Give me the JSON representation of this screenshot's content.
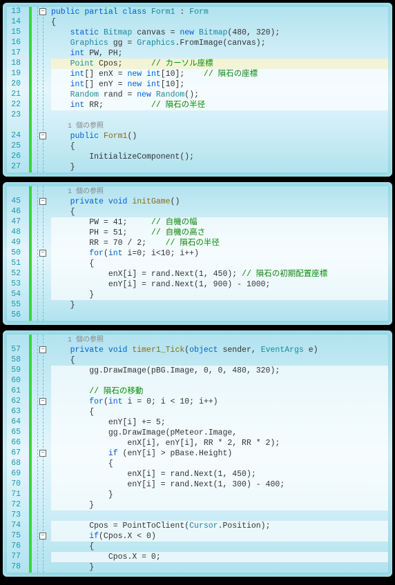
{
  "panels": [
    {
      "lines": [
        {
          "num": "13",
          "fold": "-",
          "cls": "",
          "tokens": [
            [
              "kw",
              "public"
            ],
            [
              "",
              " "
            ],
            [
              "kw",
              "partial"
            ],
            [
              "",
              " "
            ],
            [
              "kw",
              "class"
            ],
            [
              "",
              " "
            ],
            [
              "type",
              "Form1"
            ],
            [
              "",
              " : "
            ],
            [
              "type",
              "Form"
            ]
          ]
        },
        {
          "num": "14",
          "fold": "",
          "cls": "",
          "tokens": [
            [
              "",
              "{"
            ]
          ]
        },
        {
          "num": "15",
          "fold": "",
          "cls": "",
          "tokens": [
            [
              "",
              "    "
            ],
            [
              "kw",
              "static"
            ],
            [
              "",
              " "
            ],
            [
              "type",
              "Bitmap"
            ],
            [
              "",
              " canvas = "
            ],
            [
              "kw",
              "new"
            ],
            [
              "",
              " "
            ],
            [
              "type",
              "Bitmap"
            ],
            [
              "",
              "(480, 320);"
            ]
          ]
        },
        {
          "num": "16",
          "fold": "",
          "cls": "",
          "tokens": [
            [
              "",
              "    "
            ],
            [
              "type",
              "Graphics"
            ],
            [
              "",
              " gg = "
            ],
            [
              "type",
              "Graphics"
            ],
            [
              "",
              ".FromImage(canvas);"
            ]
          ]
        },
        {
          "num": "17",
          "fold": "",
          "cls": "",
          "tokens": [
            [
              "",
              "    "
            ],
            [
              "kw",
              "int"
            ],
            [
              "",
              " PW, PH;"
            ]
          ]
        },
        {
          "num": "18",
          "fold": "",
          "cls": "hl-y",
          "tokens": [
            [
              "",
              "    "
            ],
            [
              "type",
              "Point"
            ],
            [
              "",
              " Cpos;      "
            ],
            [
              "comment",
              "// カーソル座標"
            ]
          ]
        },
        {
          "num": "19",
          "fold": "",
          "cls": "hl",
          "tokens": [
            [
              "",
              "    "
            ],
            [
              "kw",
              "int"
            ],
            [
              "",
              "[] enX = "
            ],
            [
              "kw",
              "new"
            ],
            [
              "",
              " "
            ],
            [
              "kw",
              "int"
            ],
            [
              "",
              "[10];    "
            ],
            [
              "comment",
              "// 隕石の座標"
            ]
          ]
        },
        {
          "num": "20",
          "fold": "",
          "cls": "hl",
          "tokens": [
            [
              "",
              "    "
            ],
            [
              "kw",
              "int"
            ],
            [
              "",
              "[] enY = "
            ],
            [
              "kw",
              "new"
            ],
            [
              "",
              " "
            ],
            [
              "kw",
              "int"
            ],
            [
              "",
              "[10];"
            ]
          ]
        },
        {
          "num": "21",
          "fold": "",
          "cls": "hl",
          "tokens": [
            [
              "",
              "    "
            ],
            [
              "type",
              "Random"
            ],
            [
              "",
              " rand = "
            ],
            [
              "kw",
              "new"
            ],
            [
              "",
              " "
            ],
            [
              "type",
              "Random"
            ],
            [
              "",
              "();"
            ]
          ]
        },
        {
          "num": "22",
          "fold": "",
          "cls": "hl",
          "tokens": [
            [
              "",
              "    "
            ],
            [
              "kw",
              "int"
            ],
            [
              "",
              " RR;          "
            ],
            [
              "comment",
              "// 隕石の半径"
            ]
          ]
        },
        {
          "num": "23",
          "fold": "",
          "cls": "",
          "tokens": [
            [
              "",
              ""
            ]
          ]
        },
        {
          "num": "",
          "fold": "",
          "cls": "",
          "tokens": [
            [
              "ref-label",
              "    1 個の参照"
            ]
          ]
        },
        {
          "num": "24",
          "fold": "-",
          "cls": "",
          "tokens": [
            [
              "",
              "    "
            ],
            [
              "kw",
              "public"
            ],
            [
              "",
              " "
            ],
            [
              "method",
              "Form1"
            ],
            [
              "",
              "()"
            ]
          ]
        },
        {
          "num": "25",
          "fold": "",
          "cls": "",
          "tokens": [
            [
              "",
              "    {"
            ]
          ]
        },
        {
          "num": "26",
          "fold": "",
          "cls": "",
          "tokens": [
            [
              "",
              "        InitializeComponent();"
            ]
          ]
        },
        {
          "num": "27",
          "fold": "",
          "cls": "",
          "tokens": [
            [
              "",
              "    }"
            ]
          ]
        }
      ]
    },
    {
      "lines": [
        {
          "num": "",
          "fold": "",
          "cls": "",
          "tokens": [
            [
              "ref-label",
              "    1 個の参照"
            ]
          ]
        },
        {
          "num": "45",
          "fold": "-",
          "cls": "",
          "tokens": [
            [
              "",
              "    "
            ],
            [
              "kw",
              "private"
            ],
            [
              "",
              " "
            ],
            [
              "kw",
              "void"
            ],
            [
              "",
              " "
            ],
            [
              "method",
              "initGame"
            ],
            [
              "",
              "()"
            ]
          ]
        },
        {
          "num": "46",
          "fold": "",
          "cls": "",
          "tokens": [
            [
              "",
              "    {"
            ]
          ]
        },
        {
          "num": "47",
          "fold": "",
          "cls": "hl",
          "tokens": [
            [
              "",
              "        PW = 41;     "
            ],
            [
              "comment",
              "// 自機の幅"
            ]
          ]
        },
        {
          "num": "48",
          "fold": "",
          "cls": "hl",
          "tokens": [
            [
              "",
              "        PH = 51;     "
            ],
            [
              "comment",
              "// 自機の高さ"
            ]
          ]
        },
        {
          "num": "49",
          "fold": "",
          "cls": "hl",
          "tokens": [
            [
              "",
              "        RR = 70 / 2;    "
            ],
            [
              "comment",
              "// 隕石の半径"
            ]
          ]
        },
        {
          "num": "50",
          "fold": "-",
          "cls": "hl",
          "tokens": [
            [
              "",
              "        "
            ],
            [
              "kw",
              "for"
            ],
            [
              "",
              "("
            ],
            [
              "kw",
              "int"
            ],
            [
              "",
              " i=0; i<10; i++)"
            ]
          ]
        },
        {
          "num": "51",
          "fold": "",
          "cls": "hl",
          "tokens": [
            [
              "",
              "        {"
            ]
          ]
        },
        {
          "num": "52",
          "fold": "",
          "cls": "hl",
          "tokens": [
            [
              "",
              "            enX[i] = rand.Next(1, 450); "
            ],
            [
              "comment",
              "// 隕石の初期配置座標"
            ]
          ]
        },
        {
          "num": "53",
          "fold": "",
          "cls": "hl",
          "tokens": [
            [
              "",
              "            enY[i] = rand.Next(1, 900) - 1000;"
            ]
          ]
        },
        {
          "num": "54",
          "fold": "",
          "cls": "hl",
          "tokens": [
            [
              "",
              "        }"
            ]
          ]
        },
        {
          "num": "55",
          "fold": "",
          "cls": "",
          "tokens": [
            [
              "",
              "    }"
            ]
          ]
        },
        {
          "num": "56",
          "fold": "",
          "cls": "",
          "tokens": [
            [
              "",
              ""
            ]
          ]
        }
      ]
    },
    {
      "lines": [
        {
          "num": "",
          "fold": "",
          "cls": "",
          "tokens": [
            [
              "ref-label",
              "    1 個の参照"
            ]
          ]
        },
        {
          "num": "57",
          "fold": "-",
          "cls": "",
          "tokens": [
            [
              "",
              "    "
            ],
            [
              "kw",
              "private"
            ],
            [
              "",
              " "
            ],
            [
              "kw",
              "void"
            ],
            [
              "",
              " "
            ],
            [
              "method",
              "timer1_Tick"
            ],
            [
              "",
              "("
            ],
            [
              "kw",
              "object"
            ],
            [
              "",
              " sender, "
            ],
            [
              "type",
              "EventArgs"
            ],
            [
              "",
              " e)"
            ]
          ]
        },
        {
          "num": "58",
          "fold": "",
          "cls": "",
          "tokens": [
            [
              "",
              "    {"
            ]
          ]
        },
        {
          "num": "59",
          "fold": "",
          "cls": "hl",
          "tokens": [
            [
              "",
              "        gg.DrawImage(pBG.Image, 0, 0, 480, 320);"
            ]
          ]
        },
        {
          "num": "60",
          "fold": "",
          "cls": "hl",
          "tokens": [
            [
              "",
              ""
            ]
          ]
        },
        {
          "num": "61",
          "fold": "",
          "cls": "hl",
          "tokens": [
            [
              "",
              "        "
            ],
            [
              "comment",
              "// 隕石の移動"
            ]
          ]
        },
        {
          "num": "62",
          "fold": "-",
          "cls": "hl",
          "tokens": [
            [
              "",
              "        "
            ],
            [
              "kw",
              "for"
            ],
            [
              "",
              "("
            ],
            [
              "kw",
              "int"
            ],
            [
              "",
              " i = 0; i < 10; i++)"
            ]
          ]
        },
        {
          "num": "63",
          "fold": "",
          "cls": "hl",
          "tokens": [
            [
              "",
              "        {"
            ]
          ]
        },
        {
          "num": "64",
          "fold": "",
          "cls": "hl",
          "tokens": [
            [
              "",
              "            enY[i] += 5;"
            ]
          ]
        },
        {
          "num": "65",
          "fold": "",
          "cls": "hl",
          "tokens": [
            [
              "",
              "            gg.DrawImage(pMeteor.Image,"
            ]
          ]
        },
        {
          "num": "66",
          "fold": "",
          "cls": "hl",
          "tokens": [
            [
              "",
              "                enX[i], enY[i], RR * 2, RR * 2);"
            ]
          ]
        },
        {
          "num": "67",
          "fold": "-",
          "cls": "hl",
          "tokens": [
            [
              "",
              "            "
            ],
            [
              "kw",
              "if"
            ],
            [
              "",
              " (enY[i] > pBase.Height)"
            ]
          ]
        },
        {
          "num": "68",
          "fold": "",
          "cls": "hl",
          "tokens": [
            [
              "",
              "            {"
            ]
          ]
        },
        {
          "num": "69",
          "fold": "",
          "cls": "hl",
          "tokens": [
            [
              "",
              "                enX[i] = rand.Next(1, 450);"
            ]
          ]
        },
        {
          "num": "70",
          "fold": "",
          "cls": "hl",
          "tokens": [
            [
              "",
              "                enY[i] = rand.Next(1, 300) - 400;"
            ]
          ]
        },
        {
          "num": "71",
          "fold": "",
          "cls": "hl",
          "tokens": [
            [
              "",
              "            }"
            ]
          ]
        },
        {
          "num": "72",
          "fold": "",
          "cls": "hl",
          "tokens": [
            [
              "",
              "        }"
            ]
          ]
        },
        {
          "num": "73",
          "fold": "",
          "cls": "",
          "tokens": [
            [
              "",
              ""
            ]
          ]
        },
        {
          "num": "74",
          "fold": "",
          "cls": "hl",
          "tokens": [
            [
              "",
              "        Cpos = PointToClient("
            ],
            [
              "type",
              "Cursor"
            ],
            [
              "",
              ".Position);"
            ]
          ]
        },
        {
          "num": "75",
          "fold": "-",
          "cls": "hl",
          "tokens": [
            [
              "",
              "        "
            ],
            [
              "kw",
              "if"
            ],
            [
              "",
              "(Cpos.X < 0)"
            ]
          ]
        },
        {
          "num": "76",
          "fold": "",
          "cls": "",
          "tokens": [
            [
              "",
              "        {"
            ]
          ]
        },
        {
          "num": "77",
          "fold": "",
          "cls": "hl",
          "tokens": [
            [
              "",
              "            Cpos.X = 0;"
            ]
          ]
        },
        {
          "num": "78",
          "fold": "",
          "cls": "",
          "tokens": [
            [
              "",
              "        }"
            ]
          ]
        }
      ]
    }
  ]
}
